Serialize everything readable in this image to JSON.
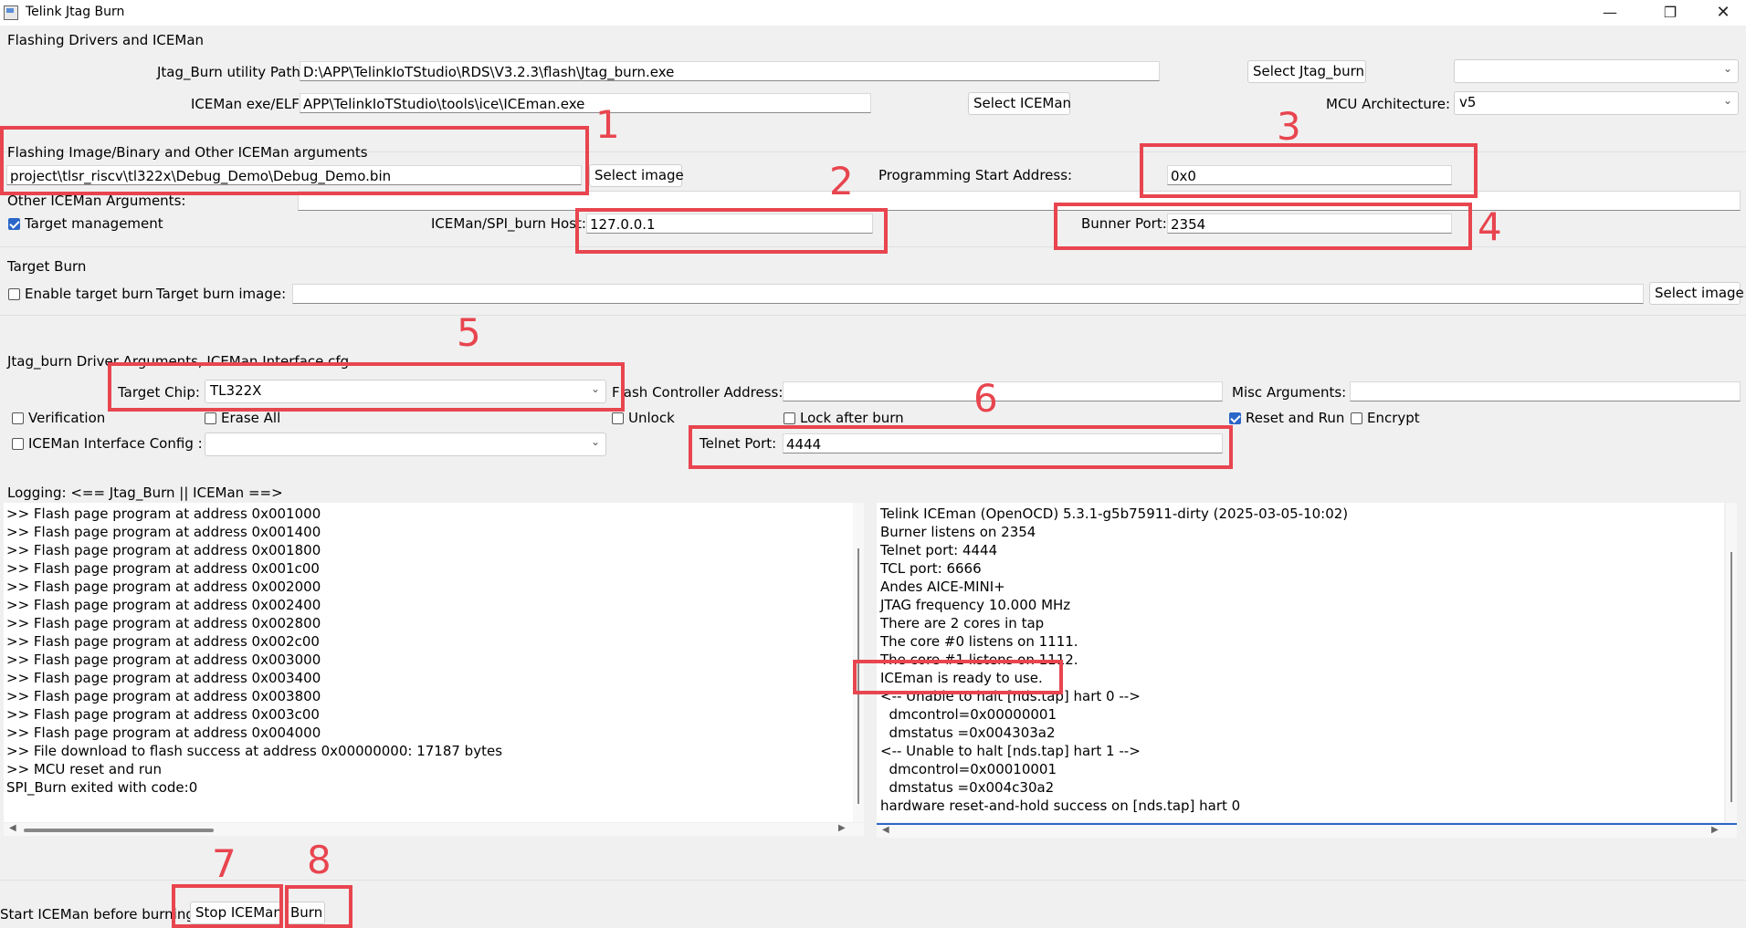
{
  "window": {
    "title": "Telink Jtag Burn"
  },
  "flashing": {
    "section_title": "Flashing Drivers and ICEMan",
    "jtag_path_label": "Jtag_Burn utility Path",
    "jtag_path_value": "D:\\APP\\TelinkIoTStudio\\RDS\\V3.2.3\\flash\\Jtag_burn.exe",
    "select_jtag_label": "Select Jtag_burn",
    "jtag_combo_value": "",
    "iceman_label": "ICEMan exe/ELF",
    "iceman_value": "APP\\TelinkIoTStudio\\tools\\ice\\ICEman.exe",
    "select_iceman_label": "Select ICEMan",
    "mcu_arch_label": "MCU Architecture:",
    "mcu_arch_value": "v5"
  },
  "image": {
    "section_title": "Flashing Image/Binary and Other ICEMan arguments",
    "path_value": "project\\tlsr_riscv\\tl322x\\Debug_Demo\\Debug_Demo.bin",
    "select_image_label": "Select image",
    "start_addr_label": "Programming Start Address:",
    "start_addr_value": "0x0",
    "other_args_label": "Other ICEMan Arguments:",
    "other_args_value": "",
    "target_mgmt_label": "Target management",
    "host_label": "ICEMan/SPI_burn Host:",
    "host_value": "127.0.0.1",
    "burner_port_label": "Bunner Port:",
    "burner_port_value": "2354"
  },
  "target_burn": {
    "section_title": "Target Burn",
    "enable_label": "Enable target burn",
    "image_label": "Target burn image:",
    "image_value": "",
    "select_image_label": "Select image"
  },
  "driver": {
    "section_title": "Jtag_burn Driver Arguments, ICEMan Interface cfg",
    "target_chip_label": "Target Chip:",
    "target_chip_value": "TL322X",
    "flash_ctrl_label": "Flash Controller Address:",
    "flash_ctrl_value": "",
    "misc_label": "Misc Arguments:",
    "misc_value": "",
    "verification_label": "Verification",
    "erase_all_label": "Erase All",
    "unlock_label": "Unlock",
    "lock_after_label": "Lock after burn",
    "reset_run_label": "Reset and Run",
    "encrypt_label": "Encrypt",
    "iceman_cfg_label": "ICEMan Interface Config :",
    "iceman_cfg_value": "",
    "telnet_label": "Telnet Port:",
    "telnet_value": "4444"
  },
  "logging": {
    "title": "Logging: <== Jtag_Burn || ICEMan ==>",
    "left": [
      ">> Flash page program at address 0x001000",
      ">> Flash page program at address 0x001400",
      ">> Flash page program at address 0x001800",
      ">> Flash page program at address 0x001c00",
      ">> Flash page program at address 0x002000",
      ">> Flash page program at address 0x002400",
      ">> Flash page program at address 0x002800",
      ">> Flash page program at address 0x002c00",
      ">> Flash page program at address 0x003000",
      ">> Flash page program at address 0x003400",
      ">> Flash page program at address 0x003800",
      ">> Flash page program at address 0x003c00",
      ">> Flash page program at address 0x004000",
      ">> File download to flash success at address 0x00000000: 17187 bytes",
      ">> MCU reset and run",
      "SPI_Burn exited with code:0"
    ],
    "right": [
      "Telink ICEman (OpenOCD) 5.3.1-g5b75911-dirty (2025-03-05-10:02)",
      "Burner listens on 2354",
      "Telnet port: 4444",
      "TCL port: 6666",
      "Andes AICE-MINI+",
      "JTAG frequency 10.000 MHz",
      "There are 2 cores in tap",
      "The core #0 listens on 1111.",
      "The core #1 listens on 1112.",
      "ICEman is ready to use.",
      "<-- Unable to halt [nds.tap] hart 0 -->",
      "  dmcontrol=0x00000001",
      "  dmstatus =0x004303a2",
      "<-- Unable to halt [nds.tap] hart 1 -->",
      "  dmcontrol=0x00010001",
      "  dmstatus =0x004c30a2",
      "hardware reset-and-hold success on [nds.tap] hart 0"
    ]
  },
  "bottom": {
    "start_label": "Start ICEMan before burning",
    "stop_button": "Stop ICEMan",
    "burn_button": "Burn"
  },
  "annotations": [
    "1",
    "2",
    "3",
    "4",
    "5",
    "6",
    "7",
    "8"
  ],
  "colors": {
    "annotation": "#e8454f",
    "checkbox": "#2b66c9"
  }
}
